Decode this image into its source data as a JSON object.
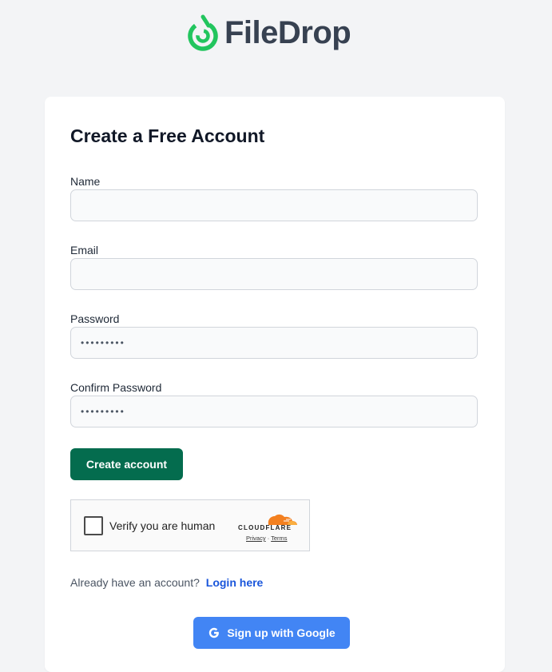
{
  "brand": {
    "name": "FileDrop",
    "logo_icon": "droplet-logo-icon",
    "color": "#22c55e"
  },
  "form": {
    "title": "Create a Free Account",
    "fields": [
      {
        "label": "Name",
        "value": "",
        "type": "text"
      },
      {
        "label": "Email",
        "value": "",
        "type": "email"
      },
      {
        "label": "Password",
        "value": "•••••••••",
        "type": "password"
      },
      {
        "label": "Confirm Password",
        "value": "•••••••••",
        "type": "password"
      }
    ],
    "submit_label": "Create account",
    "submit_color": "#046c4e"
  },
  "captcha": {
    "label": "Verify you are human",
    "brand": "CLOUDFLARE",
    "privacy": "Privacy",
    "separator": "·",
    "terms": "Terms",
    "checked": false
  },
  "login": {
    "prompt": "Already have an account?",
    "link": "Login here"
  },
  "google": {
    "label": "Sign up with Google",
    "icon": "google-g-icon",
    "color": "#4285f4"
  }
}
